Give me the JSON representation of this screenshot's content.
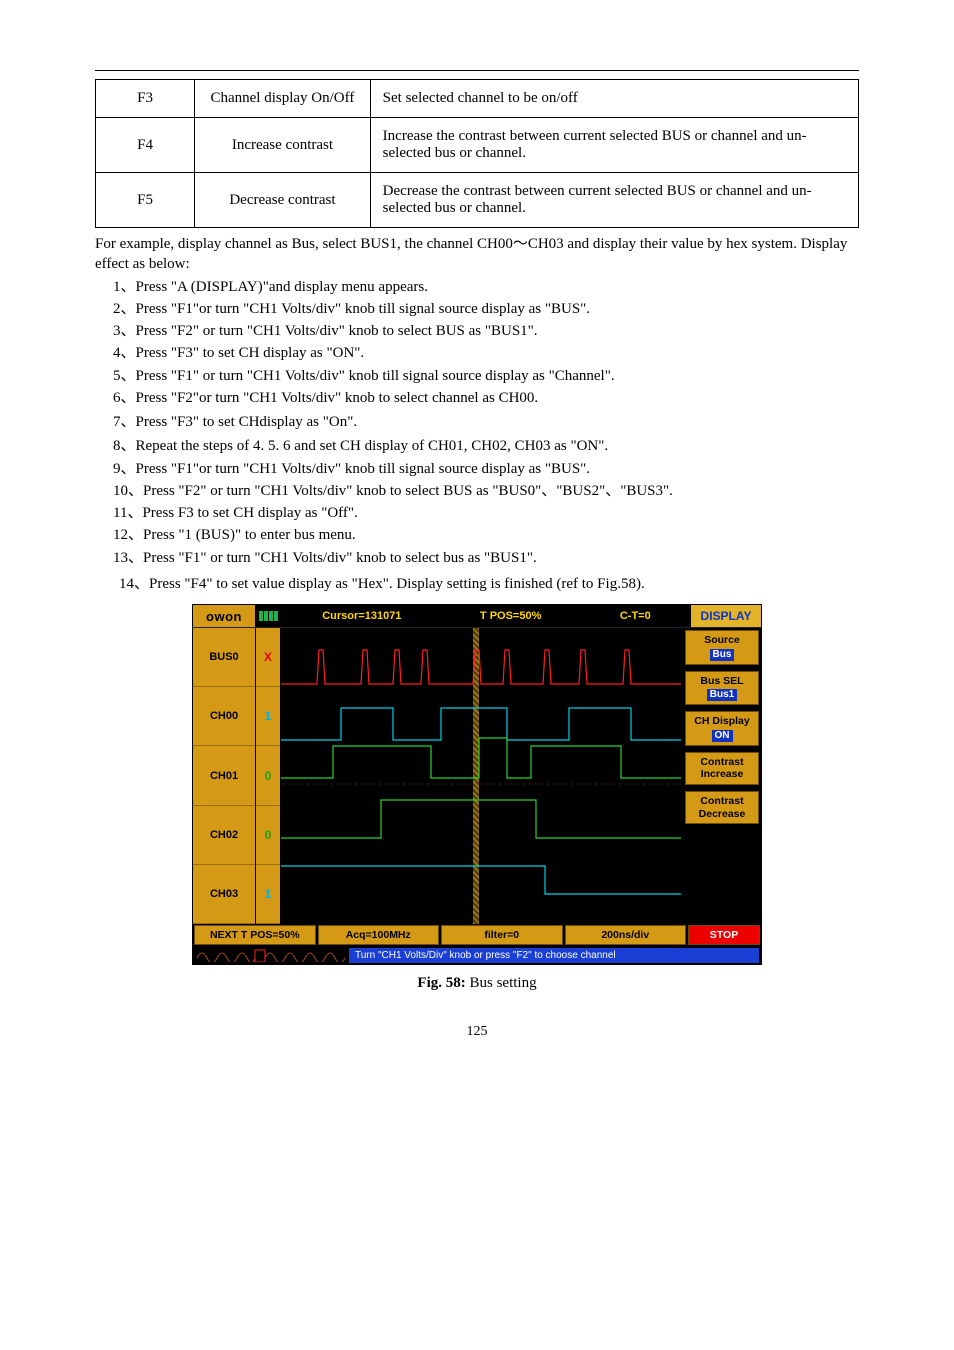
{
  "table": {
    "rows": [
      {
        "c1": "F3",
        "c2": "Channel display On/Off",
        "c3": "Set selected channel to be on/off"
      },
      {
        "c1": "F4",
        "c2": "Increase contrast",
        "c3": "Increase the contrast between current selected BUS or channel and un-selected bus or channel."
      },
      {
        "c1": "F5",
        "c2": "Decrease contrast",
        "c3": "Decrease the contrast between current selected BUS or channel and un-selected bus or channel."
      }
    ]
  },
  "instrHeader": "For example, display channel as Bus, select BUS1, the channel CH00～CH03 and display their value by hex system. Display effect as below:",
  "steps1": [
    "1、Press \"A (DISPLAY)\"and display menu appears.",
    "2、Press \"F1\"or turn \"CH1 Volts/div\" knob till signal source display as \"BUS\".",
    "3、Press \"F2\" or turn \"CH1 Volts/div\" knob to select BUS as \"BUS1\".",
    "4、Press \"F3\" to set CH display as \"ON\".",
    "5、Press \"F1\" or turn \"CH1 Volts/div\" knob till signal source display as \"Channel\".",
    "6、Press \"F2\"or turn \"CH1 Volts/div\" knob to select channel as CH00."
  ],
  "stepsSingle": "7、Press \"F3\" to set CHdisplay as \"On\".",
  "steps2": [
    "8、Repeat the steps of 4. 5. 6 and set CH display of CH01, CH02, CH03 as \"ON\".",
    "9、Press \"F1\"or turn \"CH1 Volts/div\" knob till signal source display as \"BUS\".",
    "10、Press \"F2\" or turn \"CH1 Volts/div\" knob to select BUS as \"BUS0\"、\"BUS2\"、\"BUS3\".",
    "11、Press F3 to set CH display as \"Off\".",
    "12、Press \"1 (BUS)\" to enter bus menu.",
    "13、Press \"F1\" or turn \"CH1 Volts/div\" knob to select bus as \"BUS1\"."
  ],
  "stepsLast": "14、Press \"F4\" to set value display as \"Hex\".  Display setting is finished (ref to Fig.58).",
  "osc": {
    "logo": "owon",
    "top": {
      "cursor": "Cursor=131071",
      "tpos": "T POS=50%",
      "ct": "C-T=0",
      "displayBtn": "DISPLAY"
    },
    "left": {
      "rows": [
        "BUS0",
        "CH00",
        "CH01",
        "CH02",
        "CH03"
      ],
      "vals": [
        "X",
        "1",
        "0",
        "0",
        "1"
      ]
    },
    "right": [
      {
        "label": "Source",
        "pill": "Bus"
      },
      {
        "label": "Bus SEL",
        "pill": "Bus1"
      },
      {
        "label": "CH Display",
        "pill": "ON"
      },
      {
        "label": "Contrast Increase",
        "pill": ""
      },
      {
        "label": "Contrast Decrease",
        "pill": ""
      }
    ],
    "bottom": {
      "nextt": "NEXT T POS=50%",
      "acq": "Acq=100MHz",
      "filter": "filter=0",
      "scale": "200ns/div",
      "stop": "STOP",
      "hint": "Turn \"CH1 Volts/Div\" knob or press \"F2\" to choose channel"
    }
  },
  "caption": {
    "bold": "Fig. 58:",
    "rest": " Bus setting"
  },
  "pagenum": "125"
}
